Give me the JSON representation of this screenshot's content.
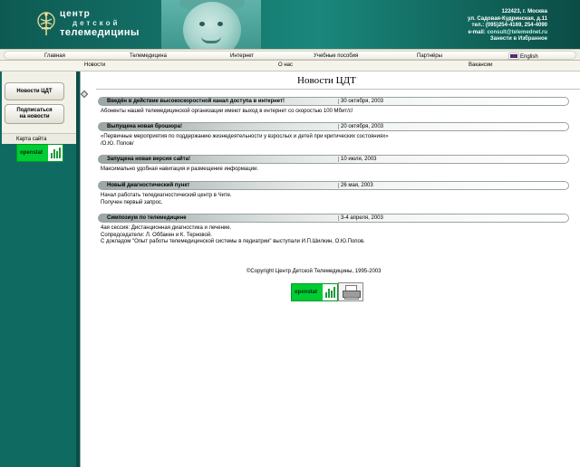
{
  "header": {
    "logo": {
      "line1": "центр",
      "line2": "детской",
      "line3": "телемедицины"
    },
    "contacts": {
      "address1": "122423, г. Москва",
      "address2": "ул. Садовая-Кудринская, д.11",
      "phone": "тел.: (095)254-4169, 254-4090",
      "email_label": "e-mail: ",
      "email": "consult@telemednet.ru",
      "favorites": "Занести в Избранное"
    }
  },
  "topmenu": {
    "items": [
      "Главная",
      "Телемедицина",
      "Интернет",
      "Учебные пособия",
      "Партнёры",
      "English"
    ]
  },
  "submenu": {
    "items": [
      "Новости",
      "О нас",
      "Вакансии"
    ]
  },
  "sidebar": {
    "tabs": [
      "Новости ЦДТ",
      "Подписаться",
      "на новости"
    ],
    "sitemap": "Карта сайта",
    "counter_label": "openstat"
  },
  "main": {
    "title": "Новости ЦДТ",
    "news": [
      {
        "title": "Введён в действие высокоскоростной канал доступа в интернет!",
        "date": "30 октября, 2003",
        "lines": [
          "Абоненты нашей телемедицинской организации имеют выход в интернет со скоростью 100 Мбит/с!"
        ]
      },
      {
        "title": "Выпущена новая брошюра!",
        "date": "20 октября, 2003",
        "lines": [
          "«Первичные мероприятия по поддержанию жизнедеятельности у взрослых и детей при критических состояниях»",
          "/О.Ю. Попов/"
        ]
      },
      {
        "title": "Запущена новая версия сайта!",
        "date": "10 июля, 2003",
        "lines": [
          "Максимально удобная навигация и размещение информации."
        ]
      },
      {
        "title": "Новый диагностический пункт",
        "date": "26 мая, 2003",
        "lines": [
          "Начал работать теледиагностический центр в Чите.",
          "Получен первый запрос."
        ]
      },
      {
        "title": "Симпозиум по телемедицине",
        "date": "3-4 апреля, 2003",
        "lines": [
          "4ая сессия: Дистанционная диагностика и лечение.",
          "Сопредседатели: Л. Оббакен и К. Терновой.",
          "С докладом \"Опыт работы телемедицинской системы в педиатрии\" выступали И.П.Шилкин, О.Ю.Попов."
        ]
      }
    ],
    "copyright": "©Copyright Центр Детской Телемедицины, 1995-2003",
    "counter_label": "openstat"
  },
  "colors": {
    "teal": "#0f6b62",
    "dark_teal": "#0a4d46",
    "counter_green": "#00cc33"
  }
}
